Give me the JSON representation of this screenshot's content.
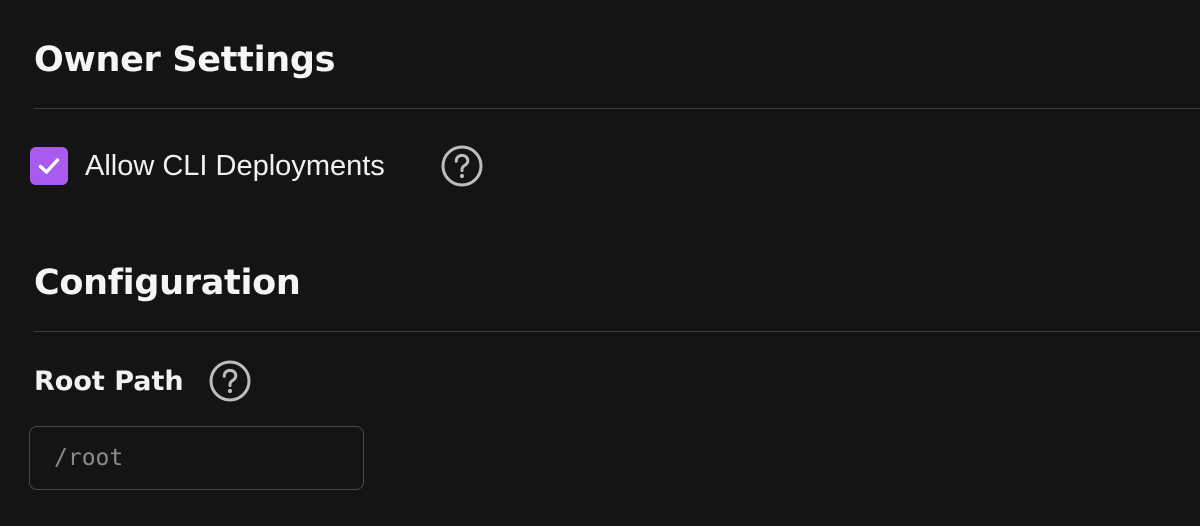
{
  "owner_settings": {
    "title": "Owner Settings",
    "allow_cli": {
      "label": "Allow CLI Deployments",
      "checked": true,
      "help_icon": "question-circle-icon"
    }
  },
  "configuration": {
    "title": "Configuration",
    "root_path": {
      "label": "Root Path",
      "help_icon": "question-circle-icon",
      "value": "",
      "placeholder": "/root"
    }
  },
  "colors": {
    "background": "#141414",
    "accent": "#a95bf0",
    "divider": "#3a3a3a",
    "help_icon": "#bdbdbd"
  }
}
